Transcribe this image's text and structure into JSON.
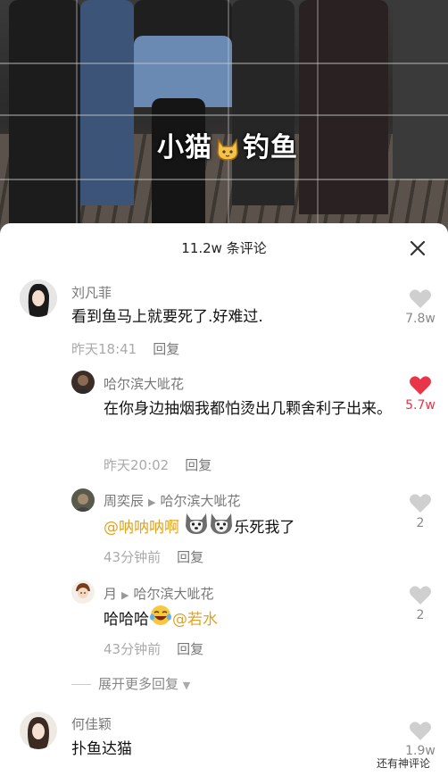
{
  "video": {
    "caption_left": "小猫",
    "caption_right": "钓鱼"
  },
  "panel": {
    "title": "11.2w 条评论",
    "close_icon": "close-icon"
  },
  "comments": [
    {
      "user": "刘凡菲",
      "text": "看到鱼马上就要死了.好难过.",
      "time": "昨天18:41",
      "reply_label": "回复",
      "likes": "7.8w",
      "liked": false
    },
    {
      "user": "哈尔滨大呲花",
      "text": "在你身边抽烟我都怕烫出几颗舍利子出来。",
      "time": "昨天20:02",
      "reply_label": "回复",
      "likes": "5.7w",
      "liked": true
    },
    {
      "user": "周奕辰",
      "reply_to": "哈尔滨大呲花",
      "mention": "@呐呐呐啊",
      "text": "乐死我了",
      "time": "43分钟前",
      "reply_label": "回复",
      "likes": "2",
      "liked": false
    },
    {
      "user": "月",
      "reply_to": "哈尔滨大呲花",
      "text": "哈哈哈",
      "mention": "@若水",
      "time": "43分钟前",
      "reply_label": "回复",
      "likes": "2",
      "liked": false
    },
    {
      "user": "何佳颖",
      "text": "扑鱼达猫",
      "likes": "1.9w",
      "liked": false
    }
  ],
  "expand_label": "展开更多回复",
  "watermark": "还有神评论",
  "colors": {
    "liked": "#e8354a",
    "unliked": "#cfcfcf",
    "mention": "#e0a322"
  }
}
